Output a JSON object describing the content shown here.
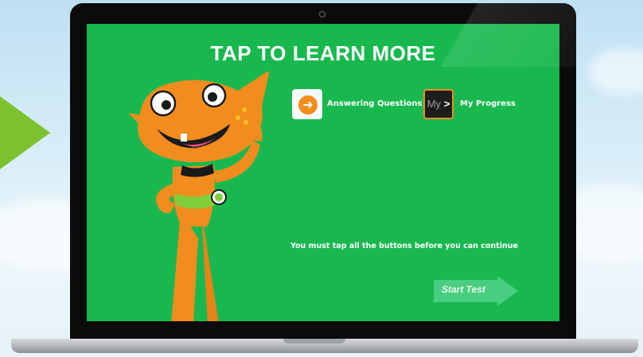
{
  "screen": {
    "title": "TAP TO LEARN MORE",
    "buttons": [
      {
        "icon": "orange-arrow-circle-icon",
        "label": "Answering Questions"
      },
      {
        "icon": "my-progress-tile-icon",
        "tile_text_dim": "My",
        "tile_text_bright": ">",
        "label": "My Progress"
      }
    ],
    "instruction": "You must tap all the buttons before you can continue",
    "start_button_label": "Start Test"
  },
  "colors": {
    "screen_bg": "#19b84f",
    "accent_orange": "#f28c1f",
    "arrow_green": "#7cc12e",
    "start_button": "#4fcf86"
  }
}
